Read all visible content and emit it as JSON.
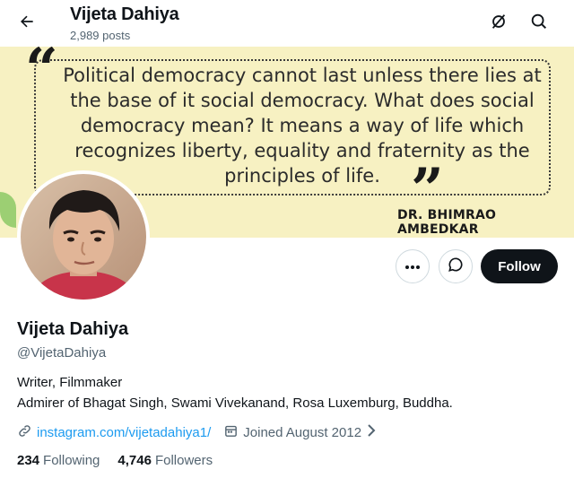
{
  "header": {
    "name": "Vijeta Dahiya",
    "posts": "2,989 posts",
    "back_icon": "arrow-left-icon",
    "icons": [
      "no-notify-icon",
      "search-icon"
    ]
  },
  "banner": {
    "quote": "Political democracy cannot last unless there lies at the base of it social democracy. What does social democracy mean? It means a way of life which recognizes liberty, equality and fraternity as the principles of life.",
    "author": "DR. BHIMRAO AMBEDKAR",
    "background_color": "#f7f1c2"
  },
  "actions": {
    "more_icon": "more-horizontal-icon",
    "message_icon": "message-bubble-icon",
    "follow_label": "Follow"
  },
  "profile": {
    "name": "Vijeta Dahiya",
    "handle": "@VijetaDahiya",
    "bio_line1": "Writer, Filmmaker",
    "bio_line2": "Admirer of Bhagat Singh, Swami Vivekanand, Rosa Luxemburg, Buddha.",
    "link": "instagram.com/vijetadahiya1/",
    "joined": "Joined August 2012",
    "following_count": "234",
    "following_label": "Following",
    "followers_count": "4,746",
    "followers_label": "Followers"
  },
  "colors": {
    "accent": "#1d9bf0",
    "text": "#0f1419",
    "muted": "#536471"
  }
}
